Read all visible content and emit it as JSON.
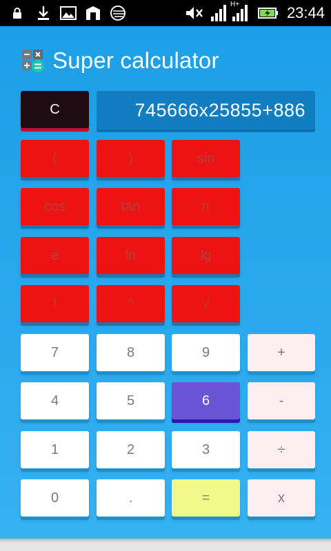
{
  "status_bar": {
    "time": "23:44",
    "network": "H+",
    "icons": [
      "lock-icon",
      "download-icon",
      "image-icon",
      "app-icon",
      "swiftkey-icon",
      "mute-icon",
      "signal-icon",
      "battery-charging-icon"
    ]
  },
  "app": {
    "title": "Super calculator",
    "logo_icon": "calculator-icon"
  },
  "display": {
    "expression": "745666x25855+886"
  },
  "buttons": {
    "clear": "C",
    "open_paren": "(",
    "close_paren": ")",
    "sin": "sin",
    "cos": "cos",
    "tan": "tan",
    "pi": "π",
    "e": "e",
    "ln": "ln",
    "lg": "lg",
    "factorial": "!",
    "power": "^",
    "sqrt": "√",
    "n7": "7",
    "n8": "8",
    "n9": "9",
    "plus": "+",
    "n4": "4",
    "n5": "5",
    "n6": "6",
    "minus": "-",
    "n1": "1",
    "n2": "2",
    "n3": "3",
    "divide": "÷",
    "n0": "0",
    "dot": ".",
    "equals": "=",
    "multiply": "x"
  },
  "colors": {
    "background": "#1d9fe5",
    "function_key": "#ee1313",
    "digit_key": "#ffffff",
    "operator_key": "#fdeef2",
    "pressed_key": "#6a55d6",
    "equals_key": "#f1f98a",
    "clear_key": "#1e0c12",
    "display": "#117ec2"
  }
}
